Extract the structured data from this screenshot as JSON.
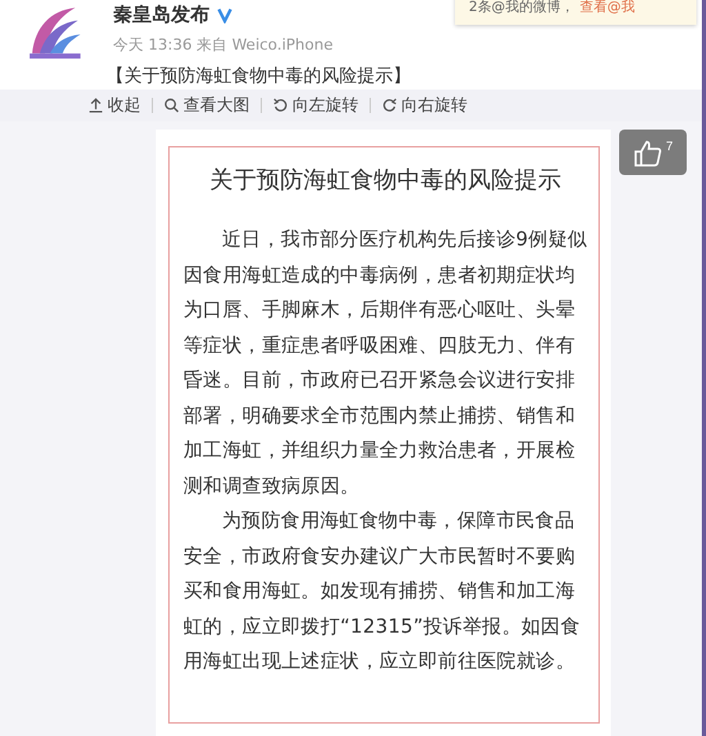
{
  "post": {
    "author": "秦皇岛发布",
    "verified": true,
    "meta": "今天 13:36 来自 Weico.iPhone",
    "text": "【关于预防海虹食物中毒的风险提示】"
  },
  "notification": {
    "text": "2条@我的微博，",
    "link": "查看@我"
  },
  "toolbar": [
    {
      "kind": "collapse",
      "label": "收起"
    },
    {
      "kind": "zoom",
      "label": "查看大图"
    },
    {
      "kind": "rotateleft",
      "label": "向左旋转"
    },
    {
      "kind": "rotateright",
      "label": "向右旋转"
    }
  ],
  "like": {
    "count": "7"
  },
  "document": {
    "title": "关于预防海虹食物中毒的风险提示",
    "paragraphs": [
      "近日，我市部分医疗机构先后接诊9例疑似因食用海虹造成的中毒病例，患者初期症状均为口唇、手脚麻木，后期伴有恶心呕吐、头晕等症状，重症患者呼吸困难、四肢无力、伴有昏迷。目前，市政府已召开紧急会议进行安排部署，明确要求全市范围内禁止捕捞、销售和加工海虹，并组织力量全力救治患者，开展检测和调查致病原因。",
      "为预防食用海虹食物中毒，保障市民食品安全，市政府食安办建议广大市民暂时不要购买和食用海虹。如发现有捕捞、销售和加工海虹的，应立即拨打“12315”投诉举报。如因食用海虹出现上述症状，应立即前往医院就诊。"
    ]
  }
}
